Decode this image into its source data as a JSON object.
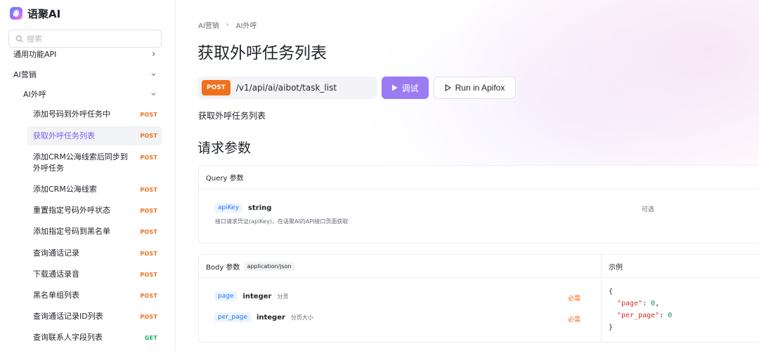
{
  "brand": {
    "name": "语聚AI"
  },
  "search": {
    "placeholder": "搜索"
  },
  "sidebar": {
    "group_general": "通用功能API",
    "group_marketing": "AI营销",
    "sub_outbound": "AI外呼",
    "items": [
      {
        "label": "添加号码到外呼任务中",
        "method": "POST"
      },
      {
        "label": "获取外呼任务列表",
        "method": "POST"
      },
      {
        "label": "添加CRM公海线索后同步到外呼任务",
        "method": "POST"
      },
      {
        "label": "添加CRM公海线索",
        "method": "POST"
      },
      {
        "label": "重置指定号码外呼状态",
        "method": "POST"
      },
      {
        "label": "添加指定号码到黑名单",
        "method": "POST"
      },
      {
        "label": "查询通话记录",
        "method": "POST"
      },
      {
        "label": "下载通话录音",
        "method": "POST"
      },
      {
        "label": "黑名单组列表",
        "method": "POST"
      },
      {
        "label": "查询通话记录ID列表",
        "method": "POST"
      },
      {
        "label": "查询联系人字段列表",
        "method": "GET"
      }
    ]
  },
  "breadcrumb": [
    "AI营销",
    "AI外呼"
  ],
  "page": {
    "title": "获取外呼任务列表",
    "method": "POST",
    "path": "/v1/api/ai/aibot/task_list",
    "debug_label": "调试",
    "apifox_label": "Run in Apifox",
    "description": "获取外呼任务列表",
    "section_title": "请求参数"
  },
  "query": {
    "header": "Query 参数",
    "param": {
      "name": "apiKey",
      "type": "string",
      "flag": "可选",
      "desc": "接口请求凭证(apiKey)，在语聚AI的API接口页面获取"
    }
  },
  "body": {
    "header": "Body 参数",
    "media_type": "application/json",
    "params": [
      {
        "name": "page",
        "type": "integer",
        "desc": "分页",
        "flag": "必需"
      },
      {
        "name": "per_page",
        "type": "integer",
        "desc": "分页大小",
        "flag": "必需"
      }
    ]
  },
  "example": {
    "header": "示例",
    "open": "{",
    "close": "}",
    "lines": [
      {
        "key": "\"page\"",
        "colon": ": ",
        "value": "0",
        "comma": ","
      },
      {
        "key": "\"per_page\"",
        "colon": ": ",
        "value": "0",
        "comma": ""
      }
    ]
  },
  "colors": {
    "accent": "#9b7bf2",
    "post": "#f0701e",
    "get": "#16b364",
    "param_tag": "#1677ff"
  }
}
